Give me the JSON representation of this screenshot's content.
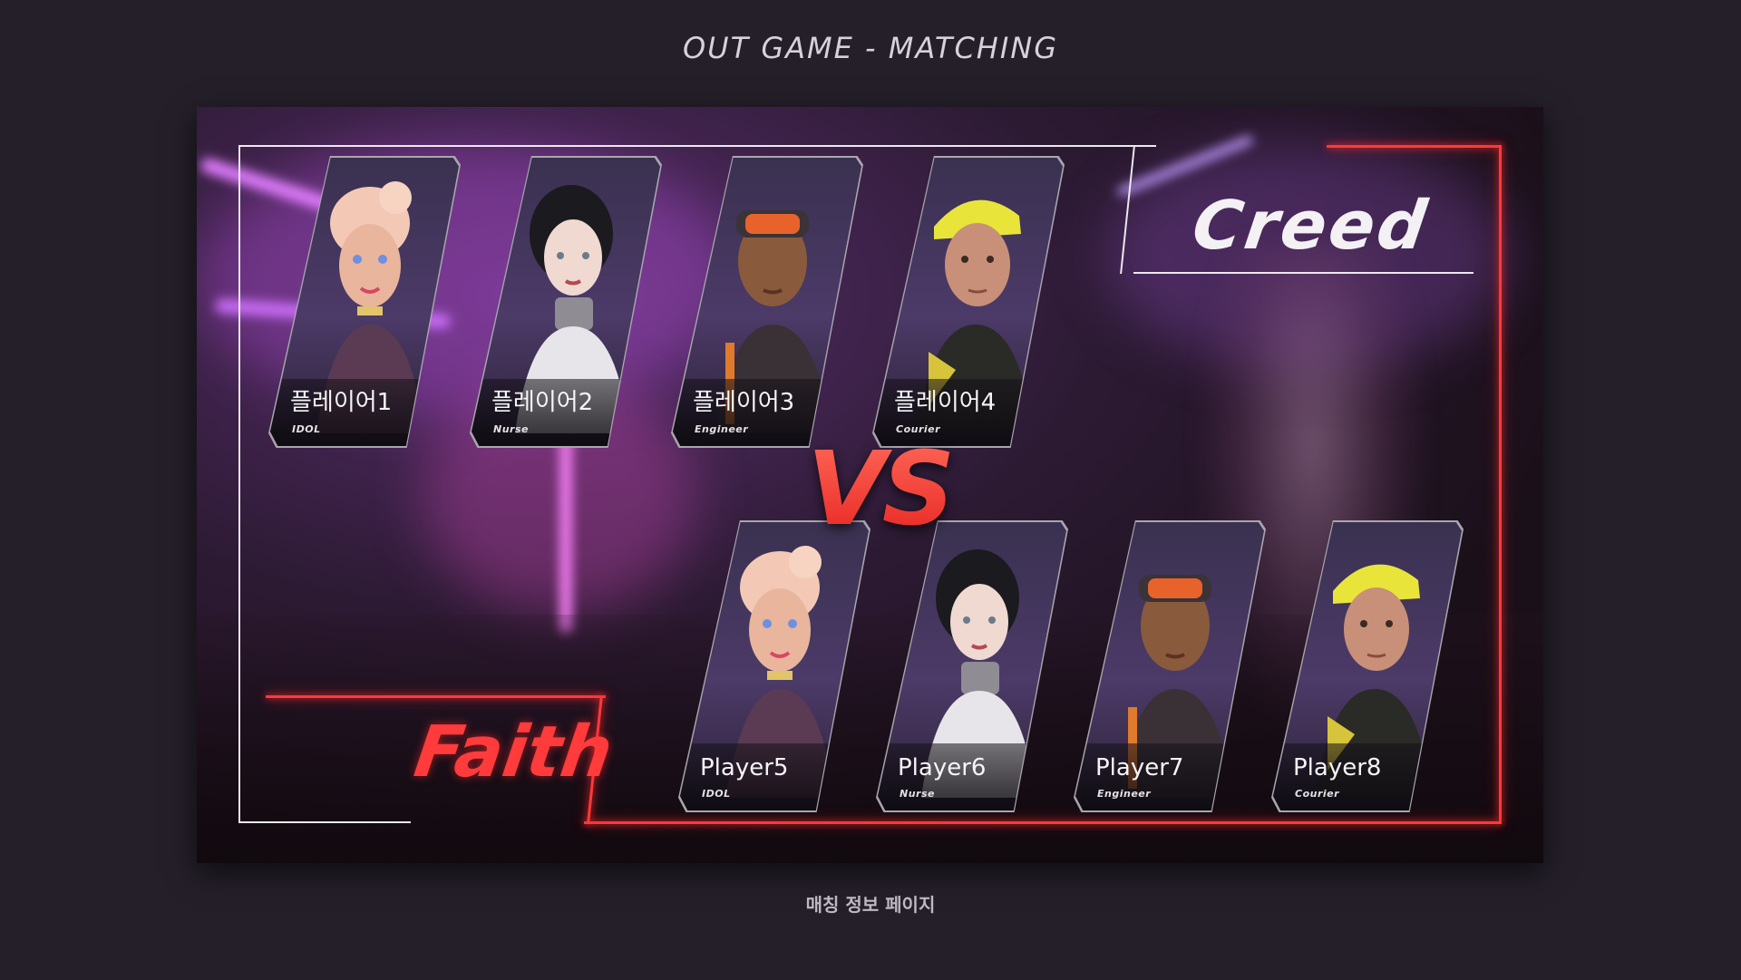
{
  "page": {
    "heading": "OUT GAME - MATCHING",
    "caption": "매칭 정보 페이지"
  },
  "match": {
    "vs_label": "VS",
    "team_top": {
      "name": "Creed",
      "accent_color": "#f4f1f4",
      "players": [
        {
          "name": "플레이어1",
          "class": "IDOL",
          "portrait": "idol-portrait"
        },
        {
          "name": "플레이어2",
          "class": "Nurse",
          "portrait": "nurse-portrait"
        },
        {
          "name": "플레이어3",
          "class": "Engineer",
          "portrait": "engineer-portrait"
        },
        {
          "name": "플레이어4",
          "class": "Courier",
          "portrait": "courier-portrait"
        }
      ]
    },
    "team_bottom": {
      "name": "Faith",
      "accent_color": "#ff3b3b",
      "players": [
        {
          "name": "Player5",
          "class": "IDOL",
          "portrait": "idol-portrait"
        },
        {
          "name": "Player6",
          "class": "Nurse",
          "portrait": "nurse-portrait"
        },
        {
          "name": "Player7",
          "class": "Engineer",
          "portrait": "engineer-portrait"
        },
        {
          "name": "Player8",
          "class": "Courier",
          "portrait": "courier-portrait"
        }
      ]
    }
  },
  "colors": {
    "background": "#241f29",
    "neon_red": "#ff3a3a",
    "neon_purple": "#c65cff"
  }
}
